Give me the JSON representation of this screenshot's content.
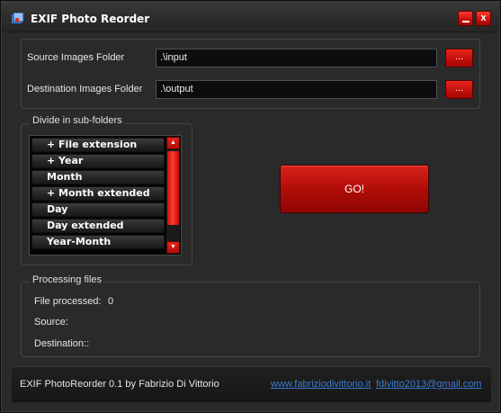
{
  "window": {
    "title": "EXIF Photo Reorder",
    "minimize_label": "_",
    "close_label": "x"
  },
  "folders": {
    "source_label": "Source Images Folder",
    "source_value": ".\\input",
    "source_browse_label": "...",
    "destination_label": "Destination Images Folder",
    "destination_value": ".\\output",
    "destination_browse_label": "..."
  },
  "divide": {
    "title": "Divide in sub-folders",
    "items": [
      {
        "label": "+ File extension"
      },
      {
        "label": "+ Year"
      },
      {
        "label": "Month"
      },
      {
        "label": "+ Month extended"
      },
      {
        "label": "Day"
      },
      {
        "label": "Day extended"
      },
      {
        "label": "Year-Month"
      }
    ]
  },
  "go_button_label": "GO!",
  "processing": {
    "title": "Processing files",
    "files_processed_label": "File processed:",
    "files_processed_value": "0",
    "source_label": "Source:",
    "destination_label": "Destination::"
  },
  "footer": {
    "credit": "EXIF PhotoReorder 0.1 by Fabrizio Di Vittorio",
    "website": "www.fabriziodivittorio.it",
    "email": "fdivitto2013@gmail.com"
  },
  "colors": {
    "accent_red": "#c80f0a",
    "background": "#2a2a2a",
    "link": "#3a7bd5"
  }
}
